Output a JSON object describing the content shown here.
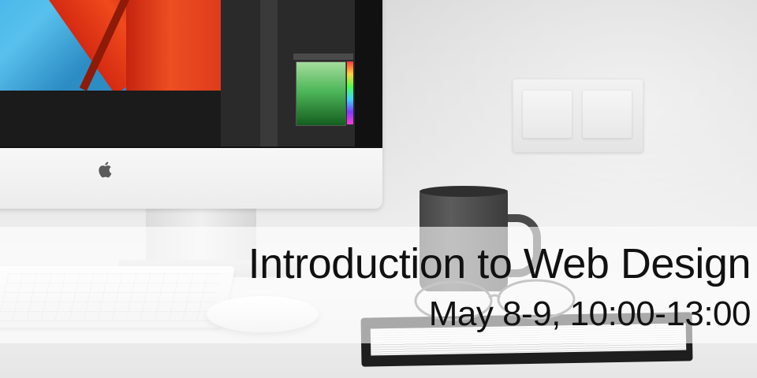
{
  "banner": {
    "title": "Introduction to Web Design",
    "schedule": "May 8-9, 10:00-13:00"
  }
}
